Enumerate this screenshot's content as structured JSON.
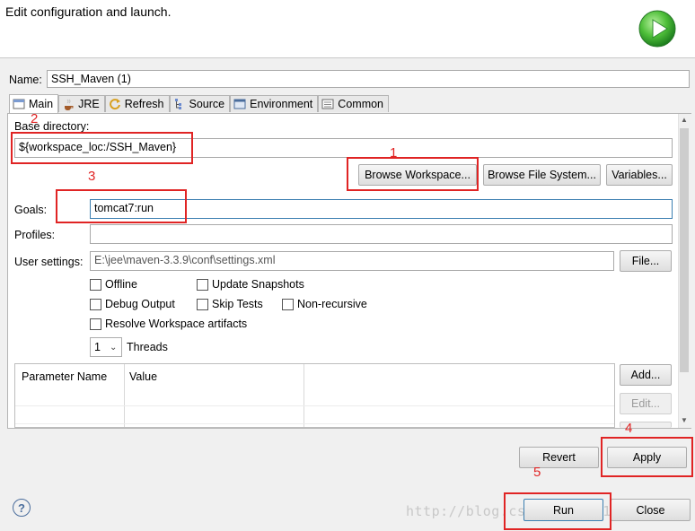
{
  "header": {
    "title": "Edit configuration and launch."
  },
  "name": {
    "label": "Name:",
    "value": "SSH_Maven (1)"
  },
  "tabs": [
    {
      "label": "Main",
      "icon": "maven-main-icon"
    },
    {
      "label": "JRE",
      "icon": "jre-icon"
    },
    {
      "label": "Refresh",
      "icon": "refresh-icon"
    },
    {
      "label": "Source",
      "icon": "source-icon"
    },
    {
      "label": "Environment",
      "icon": "environment-icon"
    },
    {
      "label": "Common",
      "icon": "common-icon"
    }
  ],
  "main": {
    "base_dir_label": "Base directory:",
    "base_dir_value": "${workspace_loc:/SSH_Maven}",
    "browse_workspace": "Browse Workspace...",
    "browse_file_system": "Browse File System...",
    "variables": "Variables...",
    "goals_label": "Goals:",
    "goals_value": "tomcat7:run",
    "profiles_label": "Profiles:",
    "profiles_value": "",
    "user_settings_label": "User settings:",
    "user_settings_value": "E:\\jee\\maven-3.3.9\\conf\\settings.xml",
    "file_button": "File...",
    "checkboxes": {
      "offline": "Offline",
      "update_snapshots": "Update Snapshots",
      "debug_output": "Debug Output",
      "skip_tests": "Skip Tests",
      "non_recursive": "Non-recursive",
      "resolve_workspace": "Resolve Workspace artifacts"
    },
    "threads_value": "1",
    "threads_label": "Threads",
    "table_headers": [
      "Parameter Name",
      "Value"
    ],
    "add_button": "Add...",
    "edit_button": "Edit..."
  },
  "buttons": {
    "revert": "Revert",
    "apply": "Apply",
    "run": "Run",
    "close": "Close"
  },
  "annotations": [
    "1",
    "2",
    "3",
    "4",
    "5"
  ],
  "help": "?",
  "watermark": "http://blog.csdn.net/u013148103",
  "colors": {
    "annotation": "#e02424",
    "run_icon": "#3aa83a",
    "focus": "#3c7fb1"
  }
}
